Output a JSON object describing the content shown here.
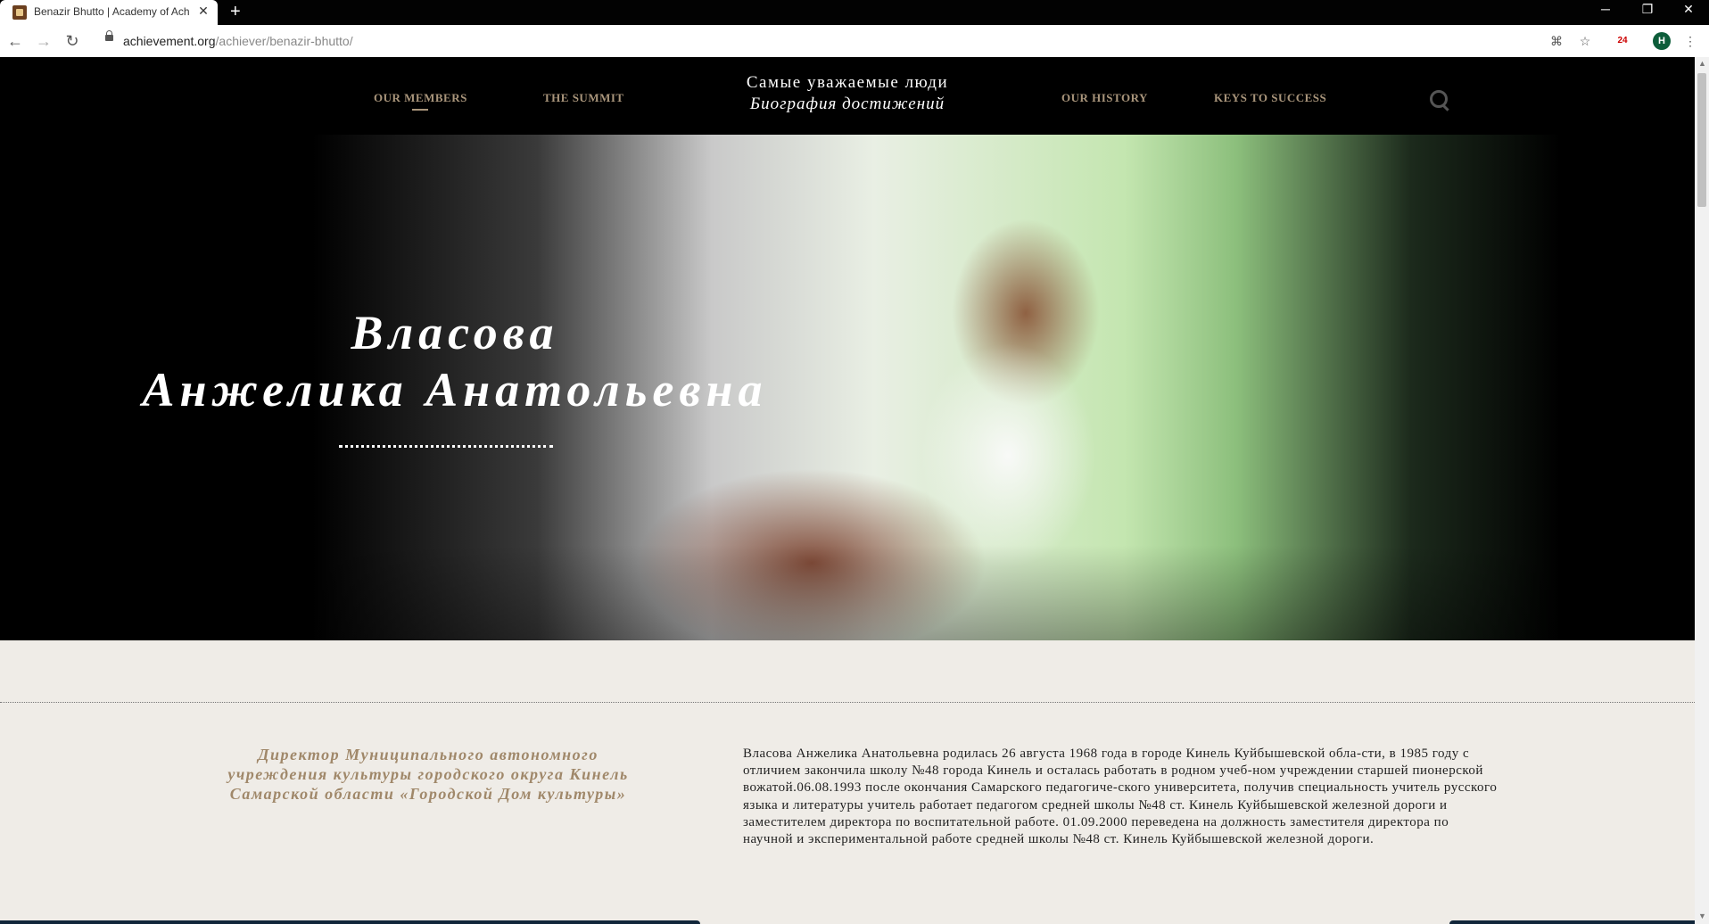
{
  "browser": {
    "tab_title": "Benazir Bhutto | Academy of Ach",
    "tab_close": "✕",
    "new_tab": "+",
    "url_domain": "achievement.org",
    "url_path": "/achiever/benazir-bhutto/",
    "profile_initial": "H",
    "extension_badge": "24"
  },
  "nav": {
    "items": [
      "OUR MEMBERS",
      "THE SUMMIT",
      "OUR HISTORY",
      "KEYS TO SUCCESS"
    ]
  },
  "brand": {
    "line1": "Самые уважаемые люди",
    "line2": "Биография достижений"
  },
  "hero": {
    "name_line1": "Власова",
    "name_line2": "Анжелика Анатольевна"
  },
  "profile": {
    "role": "Директор Муниципального автономного учреждения культуры городского округа Кинель Самарской области «Городской Дом культуры»",
    "bio": "Власова Анжелика Анатольевна родилась 26 августа 1968 года в городе Кинель Куйбышевской обла-сти, в 1985 году с отличием закончила школу №48 города Кинель и осталась работать в родном учеб-ном учреждении старшей пионерской вожатой.06.08.1993 после окончания Самарского педагогиче-ского университета, получив специальность учитель русского языка и литературы учитель работает педагогом средней школы №48 ст. Кинель Куйбышевской железной дороги и заместителем директора по воспитательной работе. 01.09.2000 переведена на должность заместителя директора по научной и экспериментальной работе средней школы №48 ст. Кинель Куйбышевской железной дороги."
  },
  "colors": {
    "nav_text": "#a9957b",
    "role_text": "#a0886a",
    "page_bg": "#efece7"
  }
}
